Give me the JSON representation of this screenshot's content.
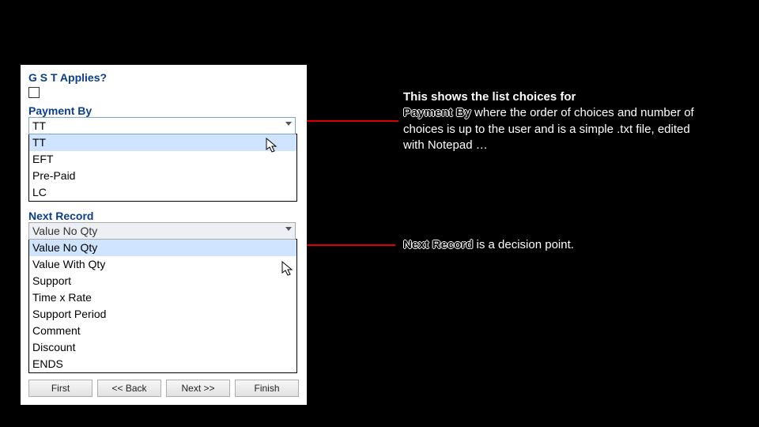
{
  "panel": {
    "gst_label": "G S T Applies?",
    "payment_by_label": "Payment By",
    "payment_by_value": "TT",
    "payment_by_options": [
      "TT",
      "EFT",
      "Pre-Paid",
      "LC"
    ],
    "next_record_label": "Next  Record",
    "next_record_value": "Value No Qty",
    "next_record_options": [
      "Value No Qty",
      "Value With Qty",
      "Support",
      "Time x Rate",
      "Support Period",
      "Comment",
      "Discount",
      "ENDS"
    ],
    "buttons": {
      "first": "First",
      "back": "<< Back",
      "next": "Next >>",
      "finish": "Finish"
    }
  },
  "annotations": {
    "a1_line1": "This shows the list choices for",
    "a1_bold": "Payment By",
    "a1_rest": "  where the order of choices and number of choices is up to the user and is a simple .txt file, edited with Notepad …",
    "a2_bold": "Next Record",
    "a2_rest": "  is a decision point."
  }
}
